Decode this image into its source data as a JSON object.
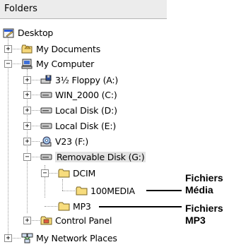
{
  "pane": {
    "title": "Folders"
  },
  "tree": {
    "desktop": "Desktop",
    "my_documents": "My Documents",
    "my_computer": "My Computer",
    "floppy": "3½ Floppy (A:)",
    "win2000": "WIN_2000 (C:)",
    "local_d": "Local Disk (D:)",
    "local_e": "Local Disk (E:)",
    "v23": "V23 (F:)",
    "removable": "Removable Disk (G:)",
    "dcim": "DCIM",
    "media100": "100MEDIA",
    "mp3": "MP3",
    "control_panel": "Control Panel",
    "network": "My Network Places"
  },
  "annotations": {
    "media_line1": "Fichiers",
    "media_line2": "Média",
    "mp3_line1": "Fichiers",
    "mp3_line2": "MP3"
  },
  "expander_symbols": {
    "plus": "+",
    "minus": "−"
  }
}
